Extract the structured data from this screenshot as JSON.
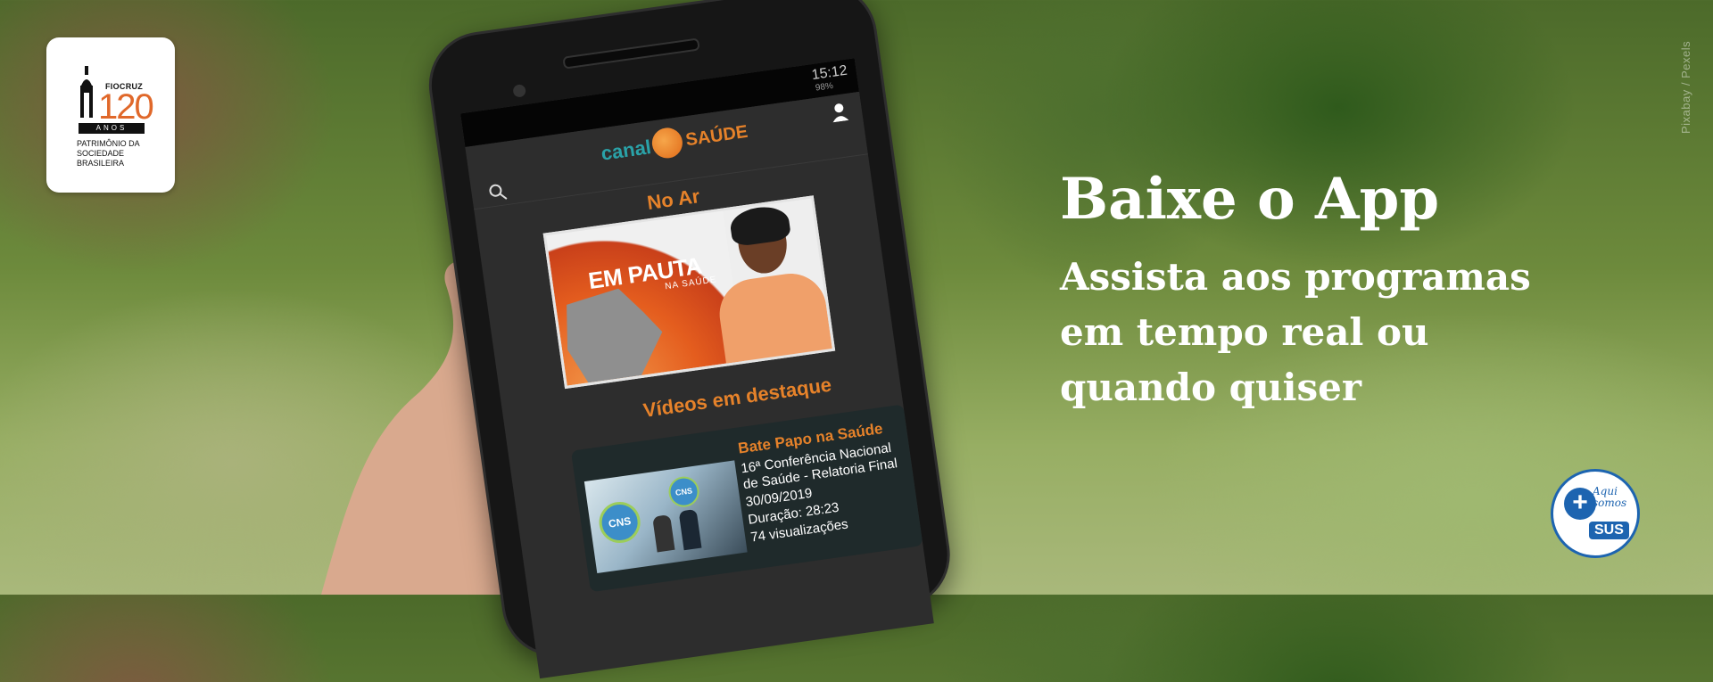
{
  "logo": {
    "org": "FIOCRUZ",
    "number": "120",
    "anos": "ANOS",
    "subtitle": "PATRIMÔNIO DA SOCIEDADE BRASILEIRA"
  },
  "credit": "Pixabay / Pexels",
  "headline": "Baixe o App",
  "subline": "Assista aos programas em tempo real ou quando quiser",
  "phone": {
    "status_time": "15:12",
    "status_battery": "98%",
    "app_logo_canal": "canal",
    "app_logo_saude": "SAÚDE",
    "section_live": "No Ar",
    "live_title": "EM PAUTA",
    "live_subtitle": "NA SAÚDE",
    "section_featured": "Vídeos em destaque",
    "card": {
      "title": "Bate Papo na Saúde",
      "line1": "16ª Conferência Nacional",
      "line2": "de Saúde - Relatoria Final",
      "date": "30/09/2019",
      "duration": "Duração: 28:23",
      "views": "74 visualizações",
      "thumb_badge": "CNS"
    }
  },
  "sus_badge": {
    "plus": "+",
    "aqui_somos": "Aqui somos",
    "label": "SUS"
  },
  "colors": {
    "accent_orange": "#e6822a",
    "canal_teal": "#2aa2a8",
    "sus_blue": "#1d64b0"
  }
}
